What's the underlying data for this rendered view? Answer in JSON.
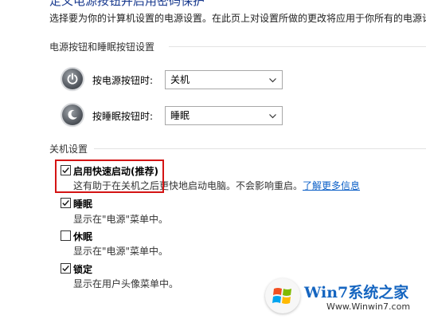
{
  "header": {
    "title": "定义电源按钮并启用密码保护",
    "intro": "选择要为你的计算机设置的电源设置。在此页上对设置所做的更改将应用于你所有的电源计"
  },
  "power_buttons": {
    "section_title": "电源按钮和睡眠按钮设置",
    "rows": [
      {
        "label": "按电源按钮时:",
        "value": "关机",
        "icon": "power-icon"
      },
      {
        "label": "按睡眠按钮时:",
        "value": "睡眠",
        "icon": "moon-icon"
      }
    ]
  },
  "shutdown": {
    "section_title": "关机设置",
    "options": [
      {
        "label": "启用快速启动(推荐)",
        "checked": true,
        "desc": "这有助于在关机之后更快地启动电脑。不会影响重启。",
        "link": "了解更多信息"
      },
      {
        "label": "睡眠",
        "checked": true,
        "desc": "显示在\"电源\"菜单中。"
      },
      {
        "label": "休眠",
        "checked": false,
        "desc": "显示在\"电源\"菜单中。"
      },
      {
        "label": "锁定",
        "checked": true,
        "desc": "显示在用户头像菜单中。"
      }
    ]
  },
  "watermark": {
    "title": "Win7系统之家",
    "url": "Www.Winwin7.com"
  },
  "colors": {
    "highlight": "#d41414",
    "link": "#0b5fc7",
    "title": "#1a3b8f"
  }
}
